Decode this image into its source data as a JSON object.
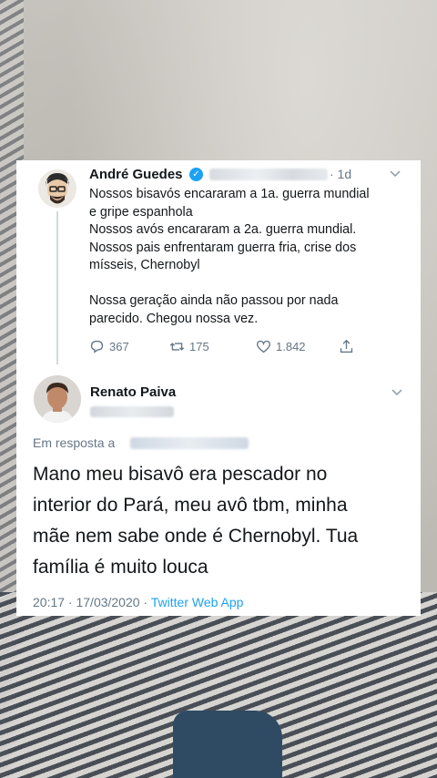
{
  "tweet": {
    "author_name": "André Guedes",
    "verified_badge": "✓",
    "time_ago": "· 1d",
    "lines": [
      "Nossos bisavós encararam a 1a. guerra mundial",
      "e gripe espanhola",
      "Nossos avós encararam a 2a. guerra mundial.",
      "Nossos pais enfrentaram guerra fria, crise dos",
      "mísseis, Chernobyl",
      "",
      "Nossa geração ainda não passou por nada",
      "parecido. Chegou nossa vez."
    ],
    "stats": {
      "replies": "367",
      "retweets": "175",
      "likes": "1.842"
    }
  },
  "reply": {
    "author_name": "Renato Paiva",
    "in_reply_to_label": "Em resposta a",
    "lines": [
      "Mano meu bisavô era pescador no",
      "interior do Pará, meu avô tbm, minha",
      "mãe nem sabe onde é Chernobyl. Tua",
      "família é muito louca"
    ],
    "timestamp": "20:17 · 17/03/2020 ·",
    "source_app": "Twitter Web App"
  },
  "colors": {
    "accent": "#1da1f2",
    "muted": "#657786",
    "text": "#14171a"
  },
  "icons": [
    "reply-icon",
    "retweet-icon",
    "like-icon",
    "share-icon",
    "verified-icon",
    "chevron-down-icon"
  ]
}
